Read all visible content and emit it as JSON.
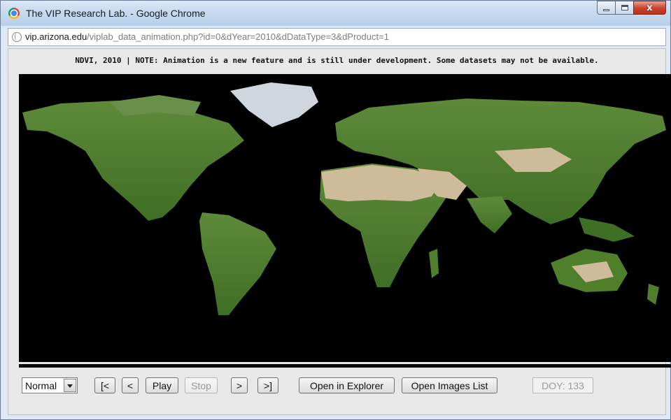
{
  "window": {
    "title": "The VIP Research Lab. - Google Chrome",
    "controls": {
      "minimize": "minimize",
      "maximize": "maximize",
      "close": "x"
    }
  },
  "address": {
    "host": "vip.arizona.edu",
    "path": "/viplab_data_animation.php?id=0&dYear=2010&dDataType=3&dProduct=1"
  },
  "notice": {
    "text": "NDVI, 2010 |  NOTE: Animation is a new feature and is still under development. Some datasets may not be available."
  },
  "map": {
    "description_icon": "world-ndvi-map",
    "ocean_color": "#000000",
    "vegetation_color": "#4f7f2b",
    "desert_color": "#cdbb9a",
    "ice_color": "#d9dde3"
  },
  "player": {
    "speed_select": {
      "value": "Normal",
      "options": [
        "Normal"
      ]
    },
    "first_label": "[<",
    "prev_label": "<",
    "play_label": "Play",
    "stop_label": "Stop",
    "next_label": ">",
    "last_label": ">]",
    "explorer_label": "Open in Explorer",
    "images_list_label": "Open Images List",
    "doy_label": "DOY: 133"
  }
}
